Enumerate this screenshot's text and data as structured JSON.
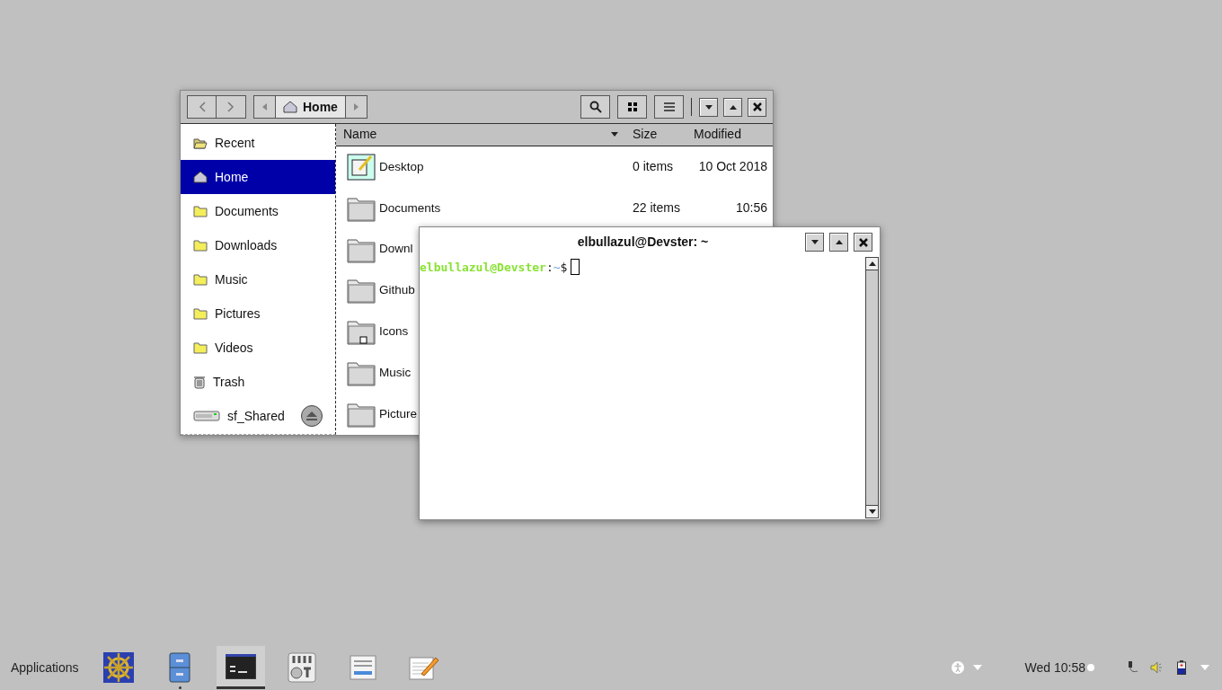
{
  "file_manager": {
    "path": {
      "label": "Home"
    },
    "sidebar": [
      {
        "label": "Recent",
        "kind": "recent",
        "selected": false
      },
      {
        "label": "Home",
        "kind": "home",
        "selected": true
      },
      {
        "label": "Documents",
        "kind": "folder",
        "selected": false
      },
      {
        "label": "Downloads",
        "kind": "folder",
        "selected": false
      },
      {
        "label": "Music",
        "kind": "folder",
        "selected": false
      },
      {
        "label": "Pictures",
        "kind": "folder",
        "selected": false
      },
      {
        "label": "Videos",
        "kind": "folder",
        "selected": false
      },
      {
        "label": "Trash",
        "kind": "trash",
        "selected": false
      },
      {
        "label": "sf_Shared",
        "kind": "drive",
        "selected": false
      }
    ],
    "columns": [
      "Name",
      "Size",
      "Modified"
    ],
    "rows": [
      {
        "name": "Desktop",
        "kind": "desktop",
        "size": "0 items",
        "modified": "10 Oct 2018"
      },
      {
        "name": "Documents",
        "kind": "folder",
        "size": "22 items",
        "modified": "10:56"
      },
      {
        "name": "Downl",
        "kind": "folder"
      },
      {
        "name": "Github",
        "kind": "folder"
      },
      {
        "name": "Icons",
        "kind": "link"
      },
      {
        "name": "Music",
        "kind": "folder"
      },
      {
        "name": "Picture",
        "kind": "folder"
      }
    ]
  },
  "terminal": {
    "title": "elbullazul@Devster: ~",
    "user_host": "elbullazul@Devster",
    "separator": ":",
    "cwd": "~",
    "prompt": "$"
  },
  "taskbar": {
    "menu": "Applications",
    "launchers": [
      {
        "kind": "helm",
        "selected": false,
        "running": false
      },
      {
        "kind": "cabinet",
        "selected": false,
        "running": true
      },
      {
        "kind": "terminal",
        "selected": true,
        "running": true
      },
      {
        "kind": "mixer",
        "selected": false,
        "running": false
      },
      {
        "kind": "form",
        "selected": false,
        "running": false
      },
      {
        "kind": "notepad",
        "selected": false,
        "running": false
      }
    ],
    "clock": "Wed 10:58"
  }
}
